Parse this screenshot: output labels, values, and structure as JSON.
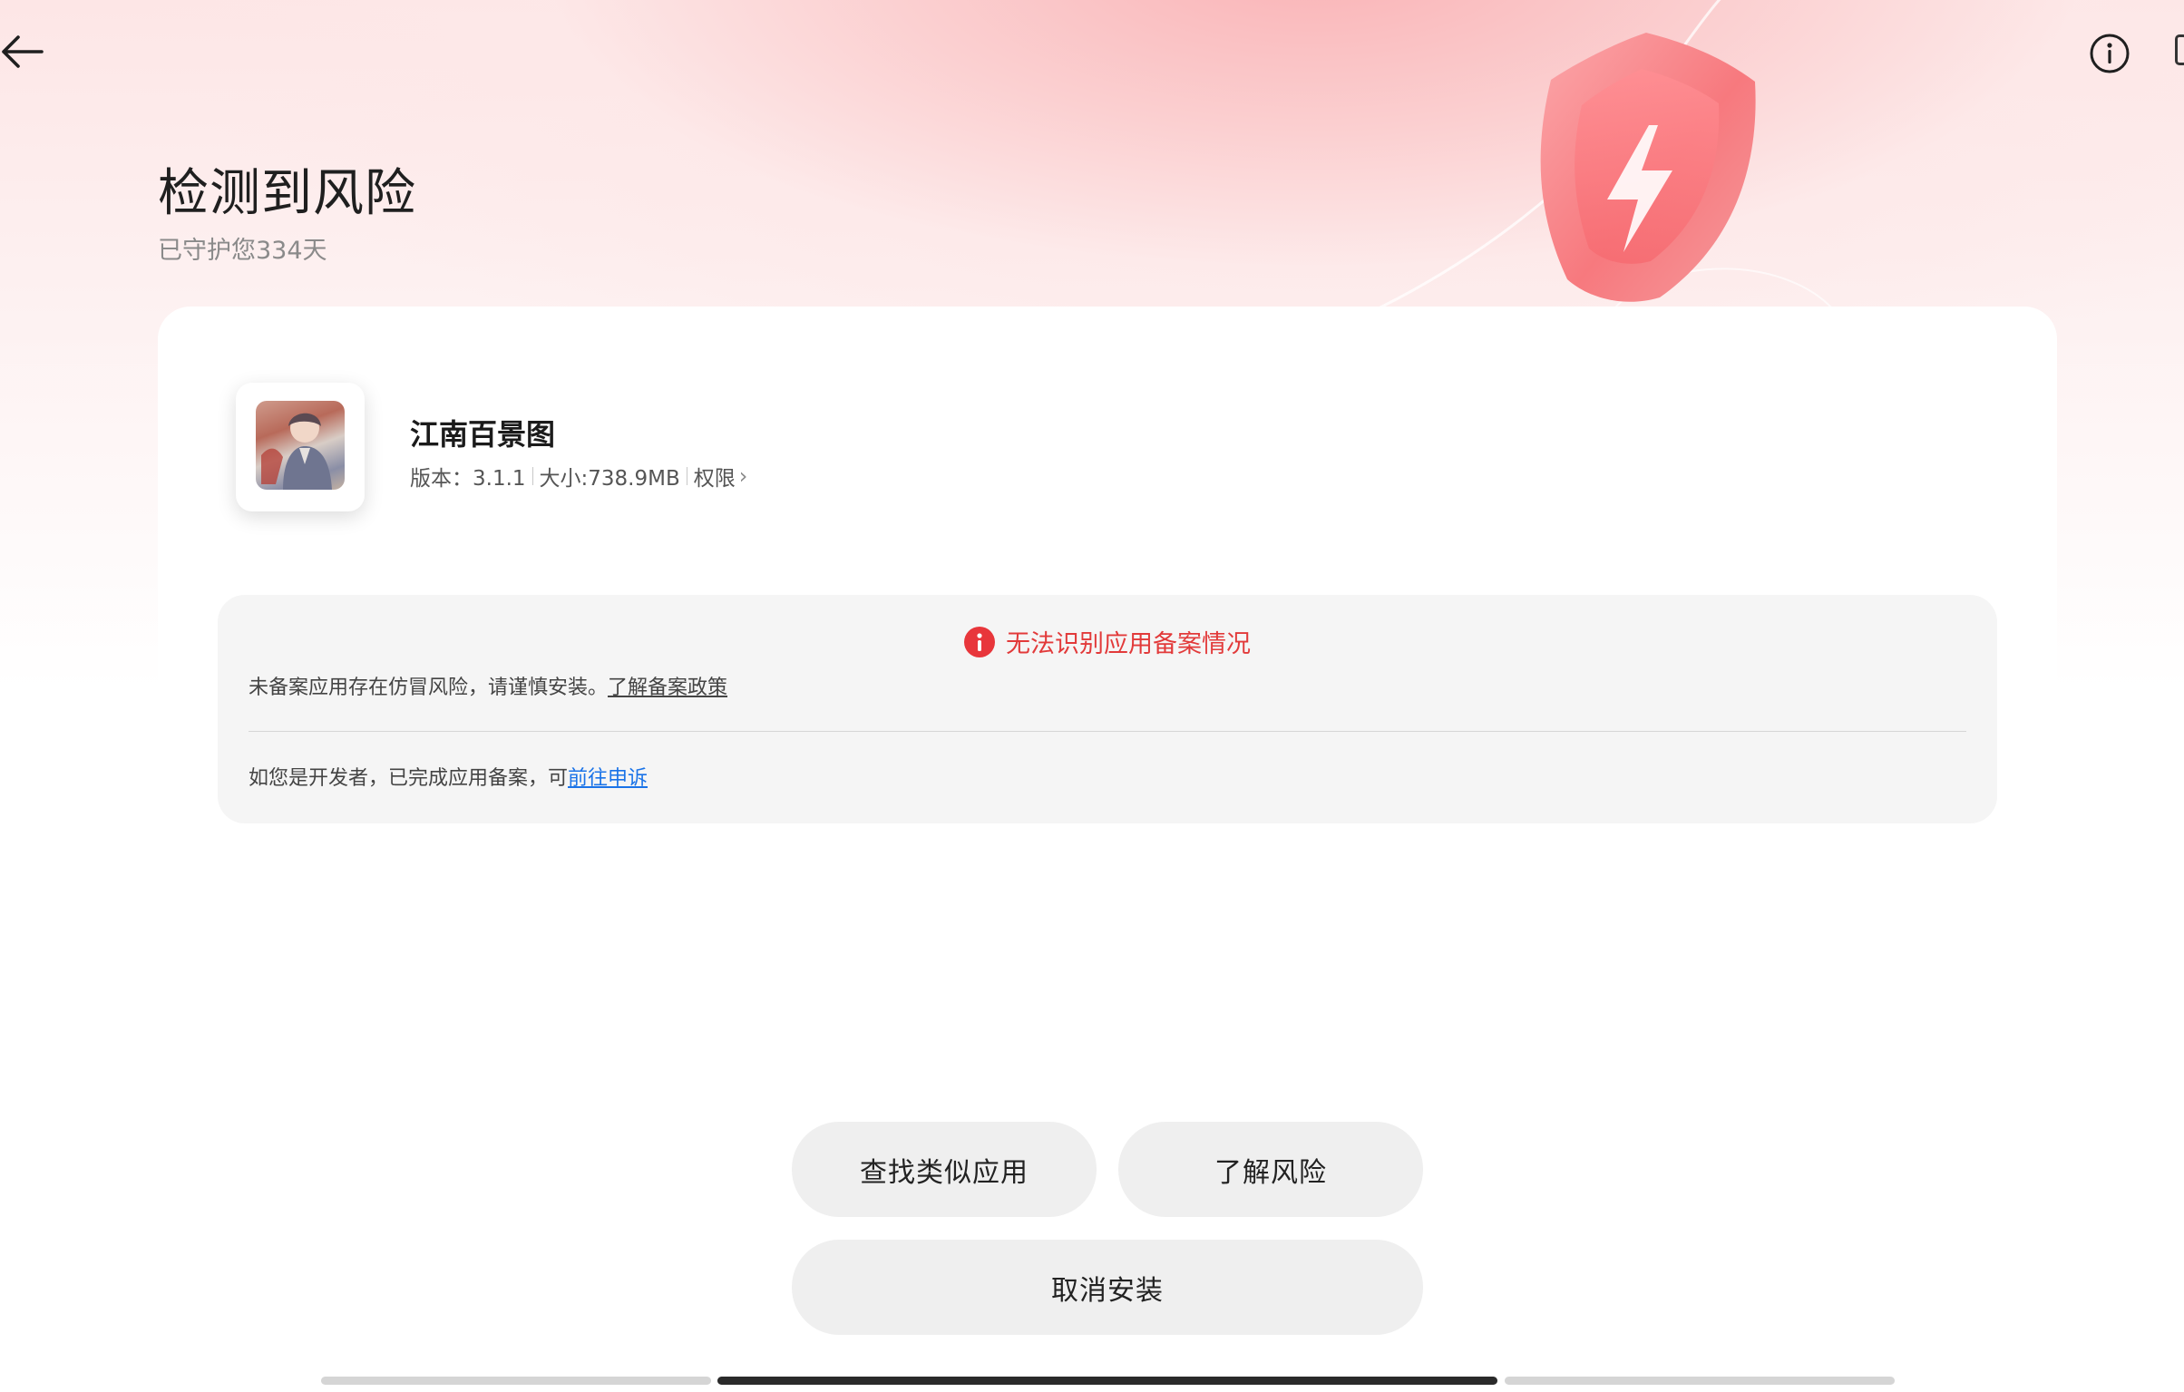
{
  "header": {
    "title": "检测到风险",
    "subtitle": "已守护您334天"
  },
  "app": {
    "name": "江南百景图",
    "version_label": "版本：3.1.1",
    "size_label": "大小:738.9MB",
    "permissions_label": "权限"
  },
  "risk": {
    "heading": "无法识别应用备案情况",
    "description": "未备案应用存在仿冒风险，请谨慎安装。",
    "policy_link": "了解备案政策",
    "developer_note": "如您是开发者，已完成应用备案，可",
    "appeal_link": "前往申诉"
  },
  "actions": {
    "find_similar": "查找类似应用",
    "learn_risk": "了解风险",
    "cancel_install": "取消安装"
  },
  "colors": {
    "alert_red": "#e8363b",
    "link_blue": "#1a73e8",
    "shield_pink": "#f7898d"
  },
  "icons": [
    "back-arrow-icon",
    "info-icon",
    "shield-lightning-icon",
    "alert-icon",
    "chevron-right-icon"
  ]
}
